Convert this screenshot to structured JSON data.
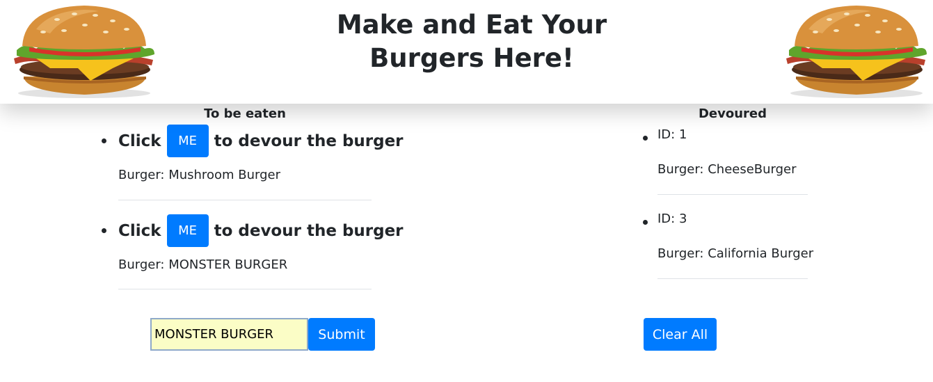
{
  "header": {
    "title_line1": "Make and Eat Your",
    "title_line2": "Burgers Here!"
  },
  "to_eat": {
    "heading": "To be eaten",
    "items": [
      {
        "prefix": "Click",
        "button_label": "ME",
        "suffix": "to devour the burger",
        "name_label": "Burger: Mushroom Burger"
      },
      {
        "prefix": "Click",
        "button_label": "ME",
        "suffix": "to devour the burger",
        "name_label": "Burger: MONSTER BURGER"
      }
    ]
  },
  "devoured": {
    "heading": "Devoured",
    "items": [
      {
        "id_label": "ID: 1",
        "name_label": "Burger: CheeseBurger"
      },
      {
        "id_label": "ID: 3",
        "name_label": "Burger: California Burger"
      }
    ]
  },
  "form": {
    "input_value": "MONSTER BURGER",
    "submit_label": "Submit",
    "clear_label": "Clear All"
  },
  "colors": {
    "primary": "#007bff",
    "input_bg": "#fbfdc6"
  },
  "icons": {
    "left": "burger-image-icon",
    "right": "burger-image-icon"
  }
}
